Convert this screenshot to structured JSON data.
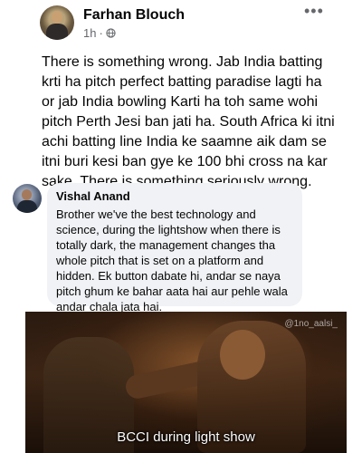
{
  "post": {
    "author": "Farhan Blouch",
    "time": "1h",
    "separator": "·",
    "privacy_icon": "globe-icon",
    "more_label": "•••",
    "text": "There is something wrong. Jab India batting\nkrti ha pitch perfect batting paradise lagti ha\nor jab India bowling Karti ha toh same wohi\npitch Perth Jesi ban jati ha. South Africa ki itni\nachi batting line India ke saamne aik dam se\nitni buri kesi ban gye ke 100 bhi cross na kar\nsake. There is something seriously wrong."
  },
  "comment": {
    "author": "Vishal Anand",
    "text": "Brother we've the best technology and\nscience, during the lightshow when there is\ntotally dark, the management changes tha\nwhole pitch that is set on a platform and\nhidden. Ek button dabate hi, andar se naya\npitch ghum ke bahar aata hai aur pehle wala\nandar chala jata hai."
  },
  "meme": {
    "watermark": "@1no_aalsi_",
    "caption": "BCCI during light show"
  }
}
